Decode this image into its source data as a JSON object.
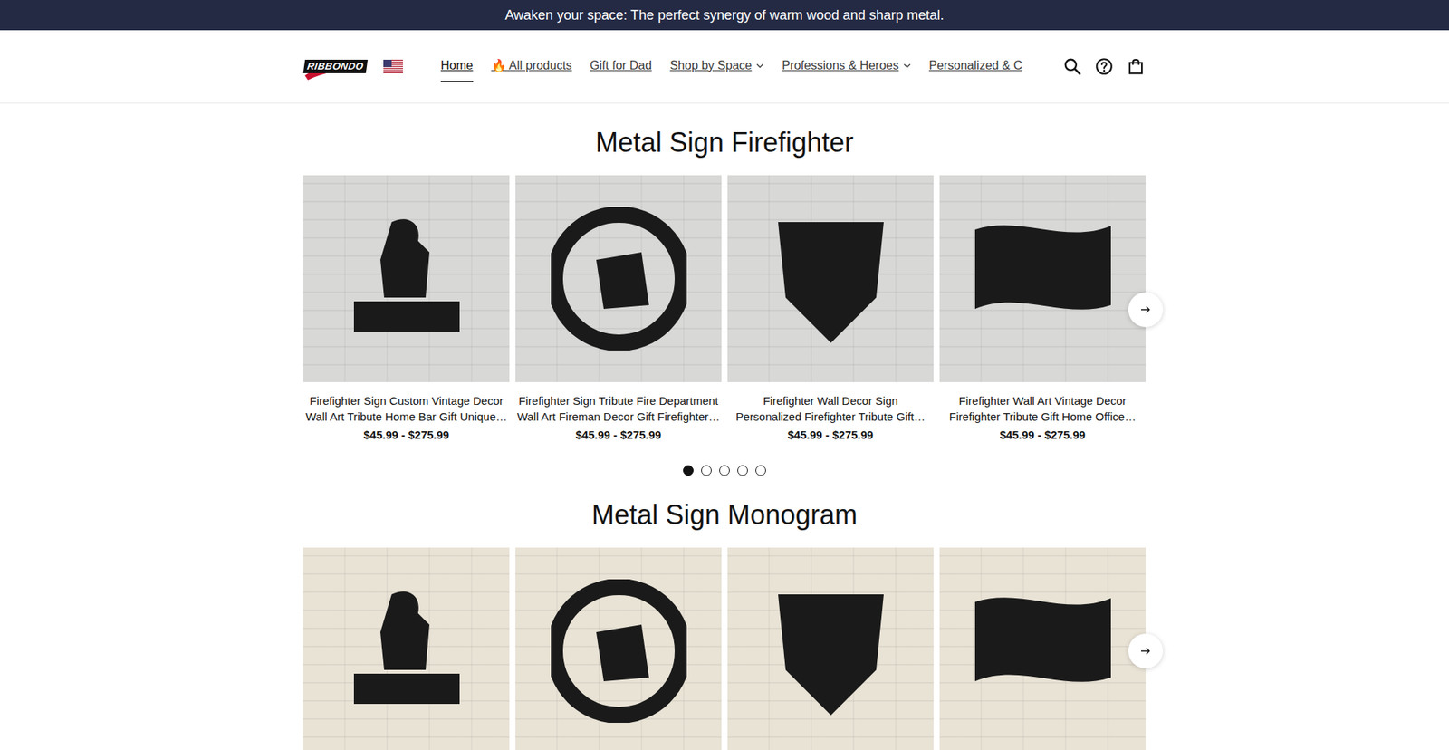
{
  "announcement": "Awaken your space: The perfect synergy of warm wood and sharp metal.",
  "header": {
    "logo": "RIBBONDO",
    "nav": [
      {
        "label": "Home",
        "selected": true,
        "has_menu": false
      },
      {
        "label": "🔥 All products",
        "selected": false,
        "has_menu": false
      },
      {
        "label": "Gift for Dad",
        "selected": false,
        "has_menu": false
      },
      {
        "label": "Shop by Space",
        "selected": false,
        "has_menu": true
      },
      {
        "label": "Professions & Heroes",
        "selected": false,
        "has_menu": true
      },
      {
        "label": "Personalized & C",
        "selected": false,
        "has_menu": false
      }
    ]
  },
  "sections": [
    {
      "title": "Metal Sign Firefighter",
      "products": [
        {
          "title": "Firefighter Sign Custom Vintage Decor Wall Art Tribute Home Bar Gift Unique…",
          "price": "$45.99 - $275.99"
        },
        {
          "title": "Firefighter Sign Tribute Fire Department Wall Art Fireman Decor Gift Firefighter…",
          "price": "$45.99 - $275.99"
        },
        {
          "title": "Firefighter Wall Decor Sign Personalized Firefighter Tribute Gift…",
          "price": "$45.99 - $275.99"
        },
        {
          "title": "Firefighter Wall Art Vintage Decor Firefighter Tribute Gift Home Office…",
          "price": "$45.99 - $275.99"
        }
      ],
      "dots": [
        {
          "selected": true
        },
        {
          "selected": false
        },
        {
          "selected": false
        },
        {
          "selected": false
        },
        {
          "selected": false
        }
      ]
    },
    {
      "title": "Metal Sign Monogram",
      "products": [
        {},
        {},
        {},
        {}
      ],
      "dots": []
    }
  ]
}
